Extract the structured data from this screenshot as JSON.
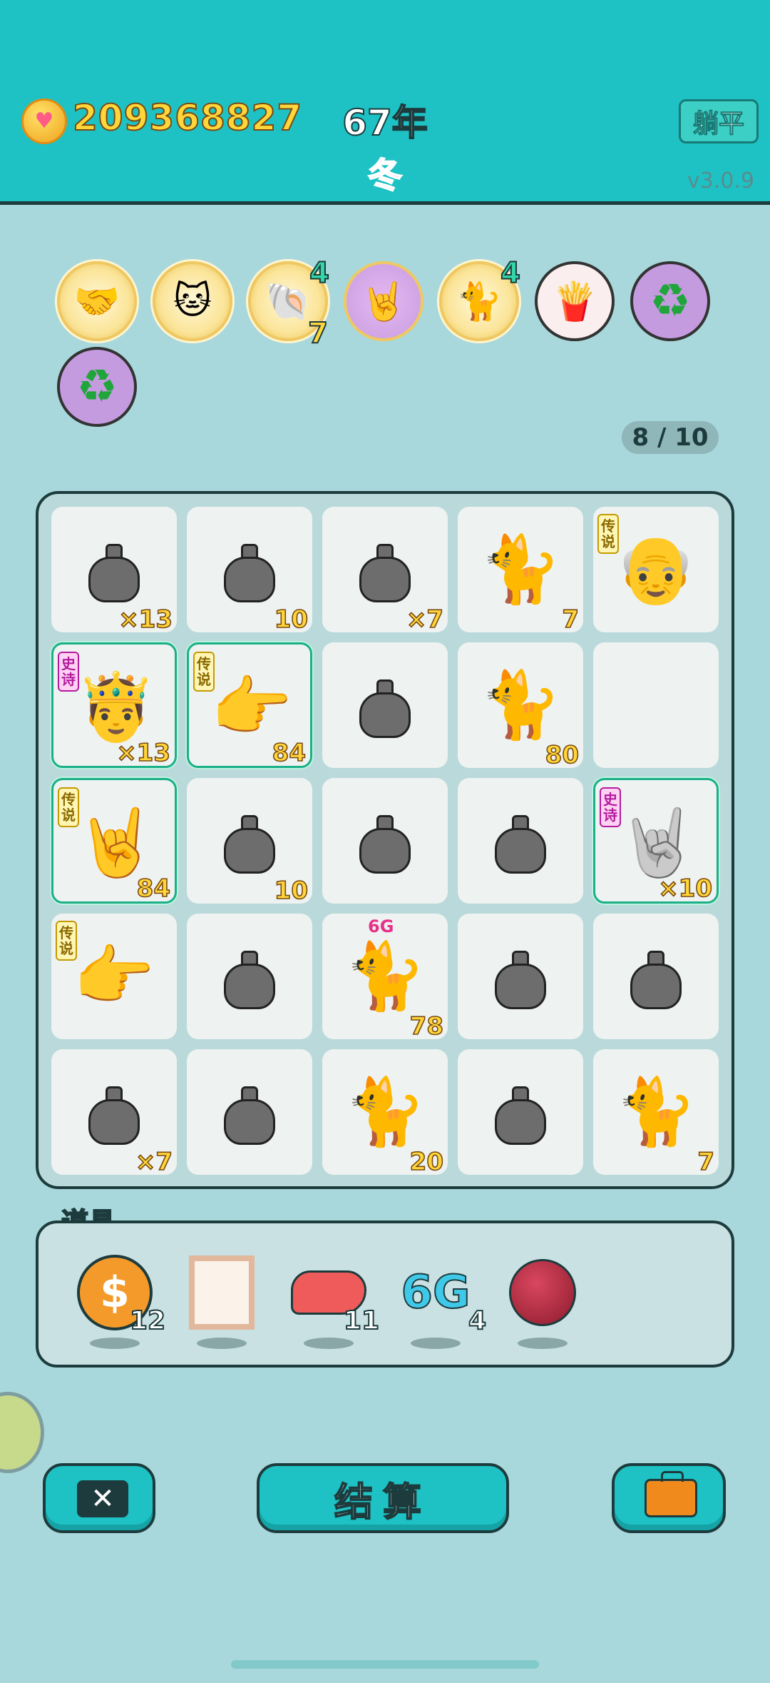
{
  "header": {
    "coins": "209368827",
    "year": "67年",
    "season": "冬",
    "lie_flat_label": "躺平",
    "version": "v3.0.9",
    "heart_icon": "heart-coin-icon"
  },
  "buffs": [
    {
      "icon": "handshake-icon",
      "glyph": "🤝",
      "style": "gold"
    },
    {
      "icon": "cat-faces-coin-icon",
      "glyph": "🐱",
      "style": "gold"
    },
    {
      "icon": "shell-icon",
      "glyph": "🐚",
      "style": "gold",
      "count_top": "4",
      "count_bottom": "7"
    },
    {
      "icon": "rock-hand-icon",
      "glyph": "🤘",
      "style": "pink"
    },
    {
      "icon": "cat-heart-icon",
      "glyph": "🐈",
      "style": "gold",
      "count_top": "4"
    },
    {
      "icon": "fries-icon",
      "glyph": "🍟",
      "style": "plain"
    },
    {
      "icon": "recycle-icon",
      "glyph": "♻",
      "style": "purple"
    },
    {
      "icon": "recycle-icon",
      "glyph": "♻",
      "style": "purple"
    }
  ],
  "capacity": "8 / 10",
  "grid": [
    {
      "type": "bag",
      "count": "×13"
    },
    {
      "type": "bag",
      "count": "10"
    },
    {
      "type": "bag",
      "count": "×7"
    },
    {
      "type": "cat",
      "count": "7"
    },
    {
      "type": "old-man",
      "tag": "传说",
      "tag_style": "legend"
    },
    {
      "type": "king",
      "count": "×13",
      "tag": "史诗",
      "tag_style": "epic",
      "glow": true
    },
    {
      "type": "point-hand",
      "count": "84",
      "tag": "传说",
      "tag_style": "legend",
      "glow": true
    },
    {
      "type": "bag"
    },
    {
      "type": "cat",
      "count": "80"
    },
    {
      "type": "empty"
    },
    {
      "type": "rock-hand",
      "count": "84",
      "tag": "传说",
      "tag_style": "legend",
      "glow": true
    },
    {
      "type": "bag",
      "count": "10"
    },
    {
      "type": "bag"
    },
    {
      "type": "bag"
    },
    {
      "type": "rock-hand-gray",
      "count": "×10",
      "tag": "史诗",
      "tag_style": "epic",
      "glow": true
    },
    {
      "type": "point-hand",
      "tag": "传说",
      "tag_style": "legend"
    },
    {
      "type": "bag"
    },
    {
      "type": "cat",
      "count": "78",
      "badge": "6G"
    },
    {
      "type": "bag"
    },
    {
      "type": "bag"
    },
    {
      "type": "bag",
      "count": "×7"
    },
    {
      "type": "bag"
    },
    {
      "type": "cat",
      "count": "20"
    },
    {
      "type": "bag"
    },
    {
      "type": "cat",
      "count": "7"
    }
  ],
  "props": {
    "label": "道具",
    "items": [
      {
        "icon": "dollar-coin-icon",
        "count": "12"
      },
      {
        "icon": "frame-icon",
        "count": ""
      },
      {
        "icon": "liver-icon",
        "count": "11"
      },
      {
        "icon": "6g-icon",
        "text": "6G",
        "count": "4"
      },
      {
        "icon": "lychee-icon",
        "count": ""
      }
    ]
  },
  "buttons": {
    "close_label": "✕",
    "settle_label": "结算",
    "bag_icon": "briefcase-icon"
  },
  "colors": {
    "header": "#1ec2c4",
    "background": "#a9d8dc",
    "accent_gold": "#ffd63a",
    "epic": "#b41ba0",
    "glow": "#1bb087"
  }
}
